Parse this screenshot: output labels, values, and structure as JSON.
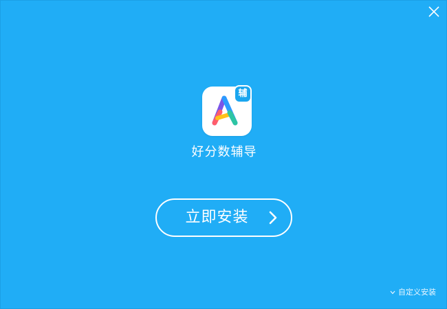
{
  "app": {
    "name": "好分数辅导",
    "badge_text": "辅"
  },
  "install_button": {
    "label": "立即安装"
  },
  "custom_install": {
    "label": "自定义安装"
  },
  "icons": {
    "close": "close-icon",
    "install_arrow": "chevron-right-icon",
    "custom_arrow": "chevron-down-icon"
  },
  "colors": {
    "background": "#20adf6",
    "foreground": "#ffffff",
    "badge": "#1aa6ef"
  }
}
